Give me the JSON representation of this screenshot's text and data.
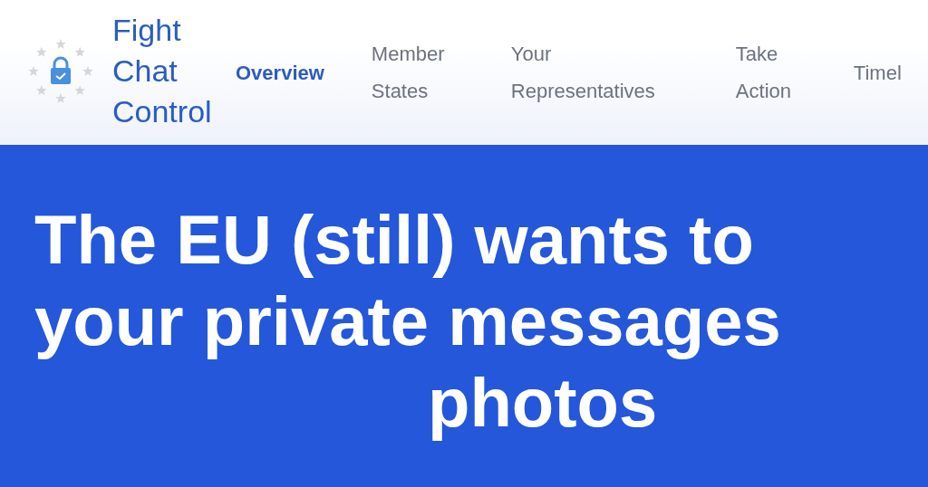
{
  "header": {
    "site_title": "Fight Chat Control",
    "nav": [
      {
        "label": "Overview",
        "selected": true
      },
      {
        "label": "Member States",
        "selected": false
      },
      {
        "label": "Your Representatives",
        "selected": false
      },
      {
        "label": "Take Action",
        "selected": false
      },
      {
        "label": "Timel",
        "selected": false
      }
    ]
  },
  "hero": {
    "headline_lines": [
      "The EU (still) wants to",
      "your private messages",
      "photos"
    ]
  }
}
